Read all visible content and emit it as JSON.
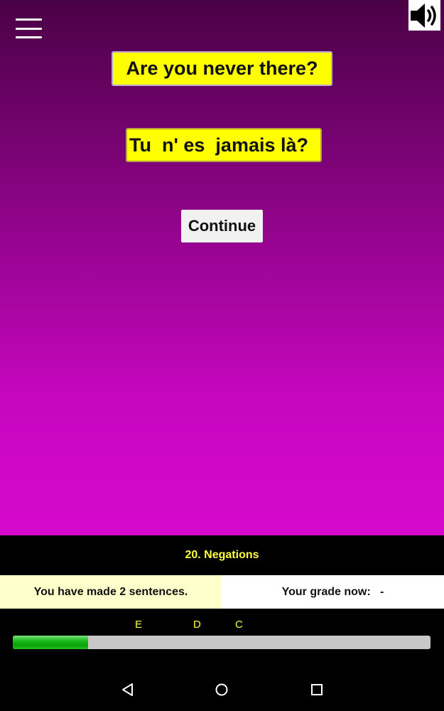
{
  "quiz": {
    "prompt": "Are you never there?",
    "answer": "Tu  n' es  jamais là?",
    "continue_label": "Continue"
  },
  "footer": {
    "lesson_title": "20. Negations",
    "sentences_made": "You have made 2 sentences.",
    "grade_label": "Your grade now:   -",
    "grade_markers": [
      "E",
      "D",
      "C"
    ],
    "progress_fraction": 0.18
  },
  "icons": {
    "menu": "menu-icon",
    "sound": "speaker-icon",
    "back": "back-icon",
    "home": "home-icon",
    "recents": "recents-icon"
  },
  "colors": {
    "card_yellow": "#ffff00",
    "accent_text": "#ffff3a",
    "progress_green": "#0aa00a",
    "gradient_top": "#4a0145",
    "gradient_bottom": "#d509cc"
  }
}
